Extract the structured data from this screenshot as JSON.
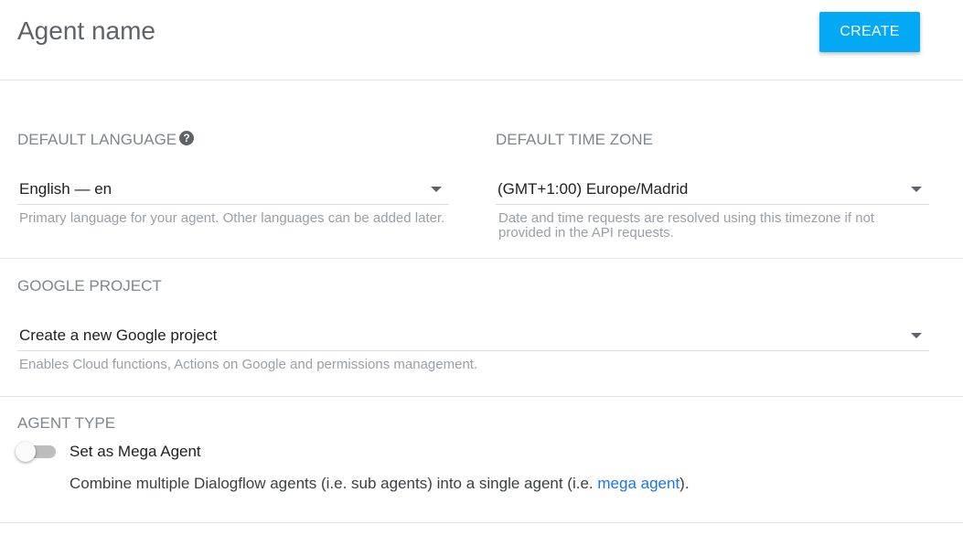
{
  "header": {
    "agent_name_placeholder": "Agent name",
    "create_label": "CREATE"
  },
  "language": {
    "label": "DEFAULT LANGUAGE",
    "value": "English — en",
    "hint": "Primary language for your agent. Other languages can be added later."
  },
  "timezone": {
    "label": "DEFAULT TIME ZONE",
    "value": "(GMT+1:00) Europe/Madrid",
    "hint": "Date and time requests are resolved using this timezone if not provided in the API requests."
  },
  "google_project": {
    "label": "GOOGLE PROJECT",
    "value": "Create a new Google project",
    "hint": "Enables Cloud functions, Actions on Google and permissions management."
  },
  "agent_type": {
    "label": "AGENT TYPE",
    "toggle_label": "Set as Mega Agent",
    "toggle_on": false,
    "description_prefix": "Combine multiple Dialogflow agents (i.e. sub agents) into a single agent (i.e. ",
    "description_link": "mega agent",
    "description_suffix": ")."
  },
  "colors": {
    "accent": "#03a9f4",
    "link": "#1a73e8"
  },
  "icons": {
    "help": "help-circle-icon",
    "caret": "dropdown-caret-icon"
  }
}
